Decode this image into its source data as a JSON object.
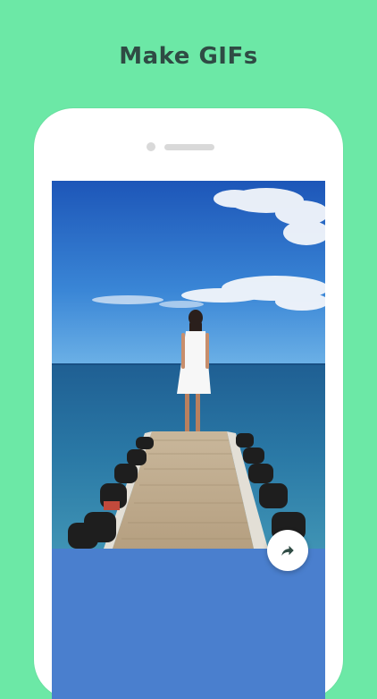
{
  "header": {
    "title": "Make GIFs"
  },
  "colors": {
    "background": "#6ce8a6",
    "screen_panel": "#4a7fce",
    "title": "#2f4b44"
  },
  "screen": {
    "share_icon": "share-arrow-icon",
    "toolbar": [
      {
        "icon": "filter-blend-icon"
      },
      {
        "icon": "magic-wand-off-icon"
      }
    ]
  }
}
